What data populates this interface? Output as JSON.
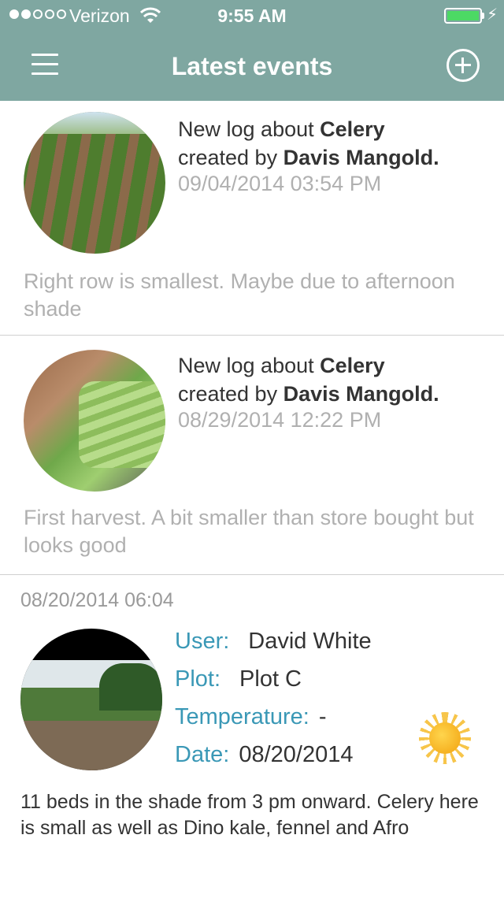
{
  "status_bar": {
    "carrier": "Verizon",
    "time": "9:55 AM",
    "battery_level": 1.0,
    "signal_bars_filled": 2,
    "signal_bars_total": 5
  },
  "nav": {
    "title": "Latest events",
    "menu_icon": "hamburger-menu-icon",
    "add_icon": "plus-circle-icon"
  },
  "events": [
    {
      "prefix": "New log about ",
      "crop": "Celery",
      "middle": "created by ",
      "author": "Davis Mangold.",
      "date": "09/04/2014 03:54 PM",
      "note": "Right row is smallest.  Maybe due to afternoon shade"
    },
    {
      "prefix": "New log about ",
      "crop": "Celery",
      "middle": "created by ",
      "author": "Davis Mangold.",
      "date": "08/29/2014 12:22 PM",
      "note": "First harvest. A bit smaller than store bought but looks good"
    }
  ],
  "detail": {
    "stamp": "08/20/2014 06:04",
    "user_label": "User:",
    "user_value": "David White",
    "plot_label": "Plot:",
    "plot_value": "Plot C",
    "temp_label": "Temperature:",
    "temp_value": "-",
    "date_label": "Date:",
    "date_value": "08/20/2014",
    "weather_icon": "sun-icon",
    "description": "11 beds in the shade from 3 pm onward. Celery here is small as well as Dino kale, fennel and Afro"
  },
  "colors": {
    "header": "#7fa7a1",
    "label_blue": "#3a98b6",
    "muted_text": "#b0b0b0",
    "battery_green": "#4cd964"
  }
}
